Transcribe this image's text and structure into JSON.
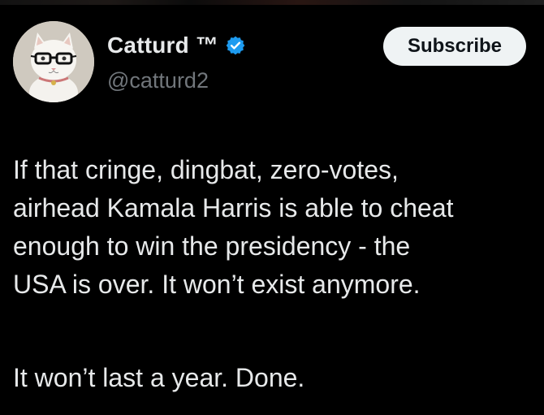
{
  "author": {
    "display_name": "Catturd ™",
    "handle": "@catturd2",
    "verified_icon": "verified-badge-icon",
    "verified_color": "#1d9bf0",
    "avatar_icon": "cat-with-glasses-avatar"
  },
  "actions": {
    "subscribe_label": "Subscribe"
  },
  "tweet": {
    "paragraph_1": "If that cringe, dingbat, zero-votes,\nairhead Kamala Harris is able to cheat\nenough to win the presidency - the\nUSA is over. It won’t exist anymore.",
    "paragraph_2": "It won’t last a year. Done."
  }
}
